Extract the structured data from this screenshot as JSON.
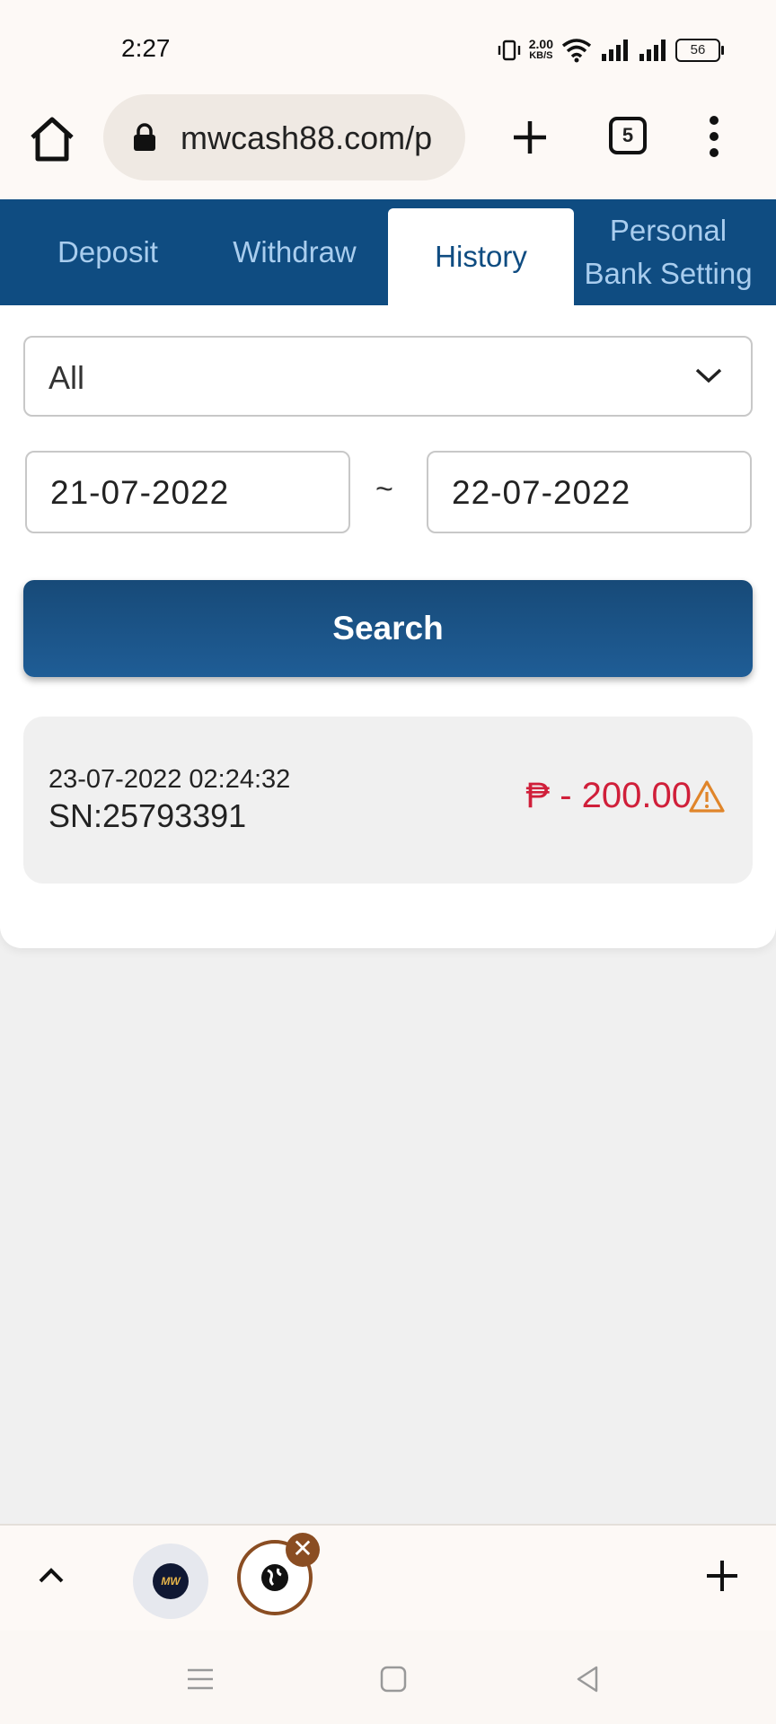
{
  "status_bar": {
    "time": "2:27",
    "net_speed_value": "2.00",
    "net_speed_unit": "KB/S",
    "battery": "56"
  },
  "browser": {
    "url": "mwcash88.com/p",
    "tab_count": "5"
  },
  "tabs": [
    {
      "label": "Deposit"
    },
    {
      "label": "Withdraw"
    },
    {
      "label": "History"
    },
    {
      "label": "Personal Bank Setting"
    }
  ],
  "filter": {
    "type_value": "All",
    "date_from": "21-07-2022",
    "separator": "~",
    "date_to": "22-07-2022",
    "search_label": "Search"
  },
  "records": [
    {
      "datetime": "23-07-2022 02:24:32",
      "sn": "SN:25793391",
      "amount": "₱ - 200.00"
    }
  ],
  "bottom_strip": {
    "tab1_logo_text": "MW",
    "close_symbol": "✕"
  },
  "colors": {
    "brand": "#0f4c81",
    "amount_negative": "#d01f3a",
    "warning": "#e0852a"
  }
}
